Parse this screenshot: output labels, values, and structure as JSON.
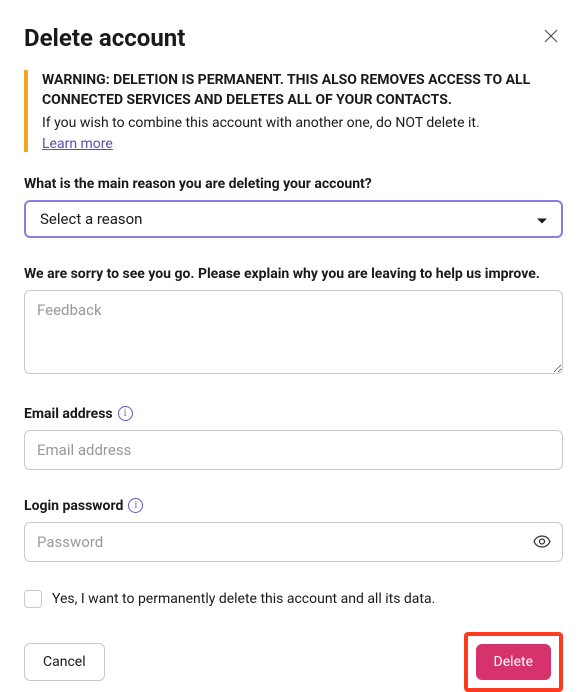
{
  "title": "Delete account",
  "warning": {
    "bold": "WARNING: DELETION IS PERMANENT. THIS ALSO REMOVES ACCESS TO ALL CONNECTED SERVICES AND DELETES ALL OF YOUR CONTACTS.",
    "text": "If you wish to combine this account with another one, do NOT delete it.",
    "learn_more": "Learn more"
  },
  "reason": {
    "label": "What is the main reason you are deleting your account?",
    "selected": "Select a reason"
  },
  "feedback": {
    "label": "We are sorry to see you go. Please explain why you are leaving to help us improve.",
    "placeholder": "Feedback",
    "value": ""
  },
  "email": {
    "label": "Email address",
    "placeholder": "Email address",
    "value": ""
  },
  "password": {
    "label": "Login password",
    "placeholder": "Password",
    "value": ""
  },
  "confirm": {
    "label": "Yes, I want to permanently delete this account and all its data.",
    "checked": false
  },
  "actions": {
    "cancel": "Cancel",
    "delete": "Delete"
  }
}
